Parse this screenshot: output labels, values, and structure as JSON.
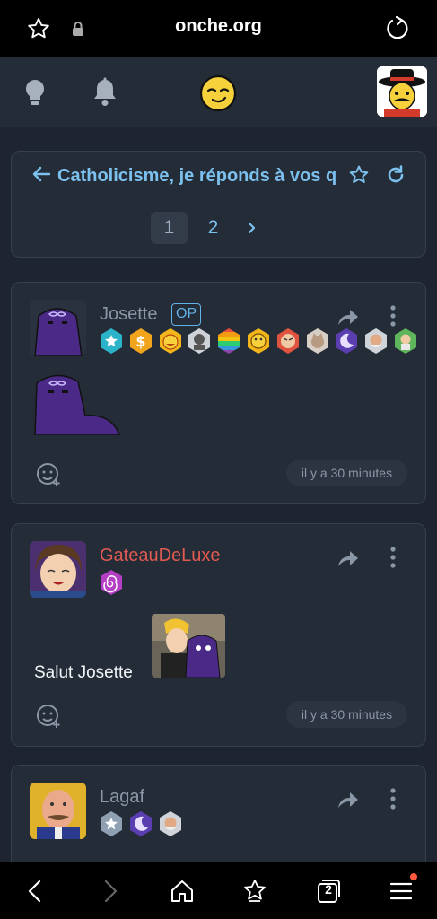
{
  "browser": {
    "url": "onche.org",
    "tabs_count": "2"
  },
  "topic": {
    "title": "Catholicisme, je réponds à vos q",
    "pages": [
      "1",
      "2"
    ],
    "current_page": "1"
  },
  "posts": [
    {
      "author": "Josette",
      "op_label": "OP",
      "time": "il y a 30 minutes",
      "badges": [
        "star-badge",
        "dollar-badge",
        "fire-face-badge",
        "portrait-badge",
        "rainbow-badge",
        "cheese-face-badge",
        "angry-face-badge",
        "cat-badge",
        "moon-badge",
        "old-man-badge",
        "green-character-badge"
      ]
    },
    {
      "author": "GateauDeLuxe",
      "text": "Salut Josette",
      "time": "il y a 30 minutes",
      "badges": [
        "spiral-badge"
      ]
    },
    {
      "author": "Lagaf",
      "badges": [
        "star-badge",
        "moon-badge",
        "portrait-badge"
      ]
    }
  ],
  "colors": {
    "accent": "#7cc0ee",
    "name_red": "#e05a52",
    "background": "#1e2530",
    "card": "#242c37"
  }
}
